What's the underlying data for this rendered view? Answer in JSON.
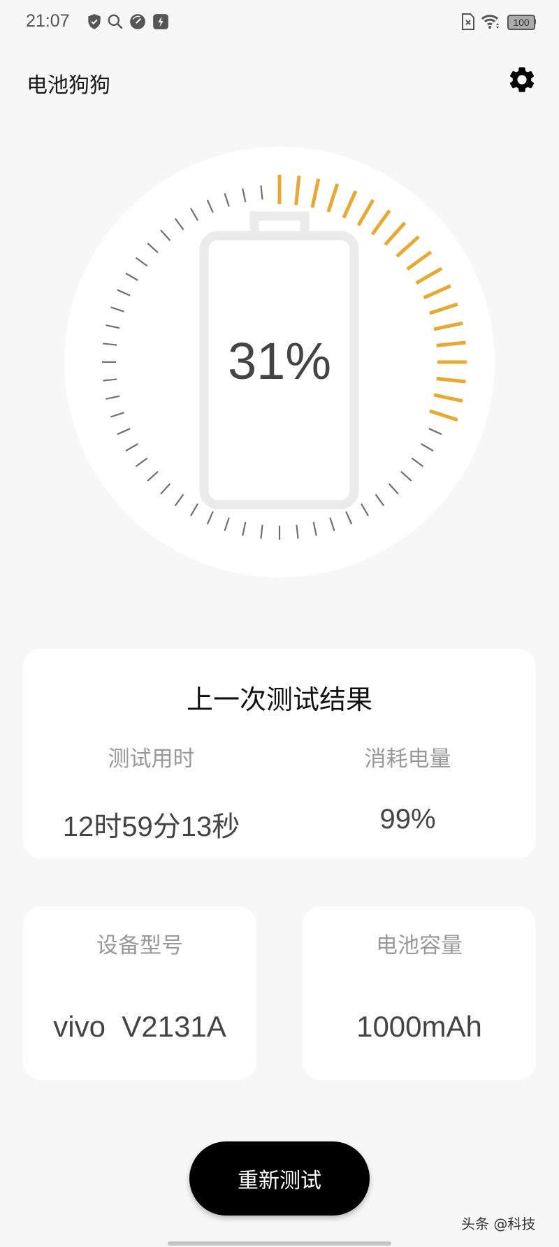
{
  "status_bar": {
    "time": "21:07",
    "left_icons": [
      "shield-check-icon",
      "search-icon",
      "gauge-icon",
      "flash-icon"
    ],
    "right_icons": [
      "no-sim-icon",
      "wifi-icon",
      "battery-icon"
    ],
    "battery_level": "100"
  },
  "header": {
    "title": "电池狗狗",
    "settings_icon": "gear-icon"
  },
  "gauge": {
    "percent_label": "31%",
    "level": 0.31,
    "tick_count": 60,
    "active_color": "#e8a831",
    "inactive_color": "#6f6f6f"
  },
  "results": {
    "title": "上一次测试结果",
    "duration_label": "测试用时",
    "duration_value": "12时59分13秒",
    "consumed_label": "消耗电量",
    "consumed_value": "99%"
  },
  "device": {
    "model_label": "设备型号",
    "model_value": "vivo  V2131A",
    "capacity_label": "电池容量",
    "capacity_value": "1000mAh"
  },
  "actions": {
    "retest_label": "重新测试"
  },
  "watermark": "头条 @科技"
}
